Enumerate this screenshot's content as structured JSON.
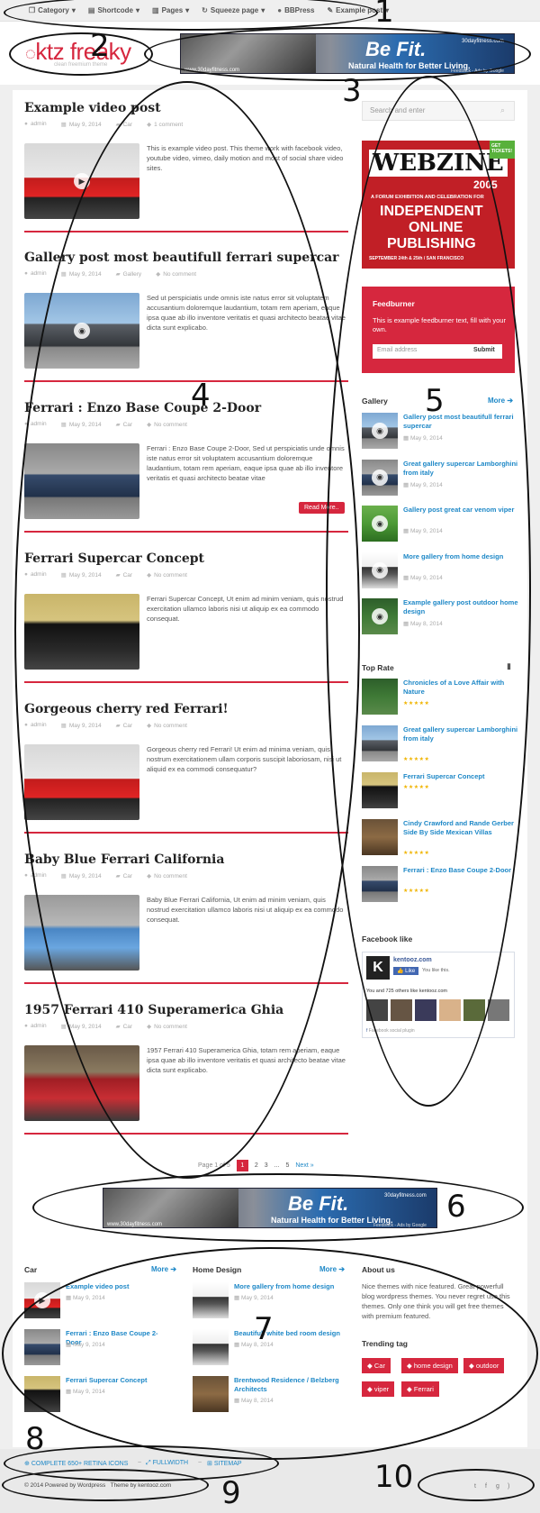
{
  "topnav": {
    "items": [
      {
        "label": "Category",
        "icon": "category-icon"
      },
      {
        "label": "Shortcode",
        "icon": "shortcode-icon"
      },
      {
        "label": "Pages",
        "icon": "pages-icon"
      },
      {
        "label": "Squeeze page",
        "icon": "squeeze-icon"
      },
      {
        "label": "BBPress",
        "icon": "bbpress-icon"
      },
      {
        "label": "Example post",
        "icon": "example-icon"
      }
    ]
  },
  "header": {
    "logo_text": "ktz freaky",
    "logo_tagline": "clean freemium theme"
  },
  "banner": {
    "headline": "Be Fit.",
    "subline": "Natural Health for Better Living.",
    "site_top": "30dayfitness.com",
    "site_bottom": "www.30dayfitness.com",
    "ads_by": "Feedback - Ads by Google"
  },
  "posts": [
    {
      "title": "Example video post",
      "author": "admin",
      "date": "May 9, 2014",
      "category": "Car",
      "comments": "1 comment",
      "excerpt": "This is example video post. This theme work with facebook video, youtube video, vimeo, daily motion and most of social share video sites.",
      "read_more": ""
    },
    {
      "title": "Gallery post most beautifull ferrari supercar",
      "author": "admin",
      "date": "May 9, 2014",
      "category": "Gallery",
      "comments": "No comment",
      "excerpt": "Sed ut perspiciatis unde omnis iste natus error sit voluptatem accusantium doloremque laudantium, totam rem aperiam, eaque ipsa quae ab illo inventore veritatis et quasi architecto beatae vitae dicta sunt explicabo.",
      "read_more": ""
    },
    {
      "title": "Ferrari : Enzo Base Coupe 2-Door",
      "author": "admin",
      "date": "May 9, 2014",
      "category": "Car",
      "comments": "No comment",
      "excerpt": "Ferrari : Enzo Base Coupe 2-Door, Sed ut perspiciatis unde omnis iste natus error sit voluptatem accusantium doloremque laudantium, totam rem aperiam, eaque ipsa quae ab illo inventore veritatis et quasi architecto beatae vitae",
      "read_more": "Read More.."
    },
    {
      "title": "Ferrari Supercar Concept",
      "author": "admin",
      "date": "May 9, 2014",
      "category": "Car",
      "comments": "No comment",
      "excerpt": "Ferrari Supercar Concept, Ut enim ad minim veniam, quis nostrud exercitation ullamco laboris nisi ut aliquip ex ea commodo consequat.",
      "read_more": ""
    },
    {
      "title": "Gorgeous cherry red Ferrari!",
      "author": "admin",
      "date": "May 9, 2014",
      "category": "Car",
      "comments": "No comment",
      "excerpt": "Gorgeous cherry red Ferrari! Ut enim ad minima veniam, quis nostrum exercitationem ullam corporis suscipit laboriosam, nisi ut aliquid ex ea commodi consequatur?",
      "read_more": ""
    },
    {
      "title": "Baby Blue Ferrari California",
      "author": "admin",
      "date": "May 9, 2014",
      "category": "Car",
      "comments": "No comment",
      "excerpt": "Baby Blue Ferrari California, Ut enim ad minim veniam, quis nostrud exercitation ullamco laboris nisi ut aliquip ex ea commodo consequat.",
      "read_more": ""
    },
    {
      "title": "1957 Ferrari 410 Superamerica Ghia",
      "author": "admin",
      "date": "May 9, 2014",
      "category": "Car",
      "comments": "No comment",
      "excerpt": "1957 Ferrari 410 Superamerica Ghia, totam rem aperiam, eaque ipsa quae ab illo inventore veritatis et quasi architecto beatae vitae dicta sunt explicabo.",
      "read_more": ""
    }
  ],
  "pagination": {
    "label": "Page 1 of 5",
    "current": "1",
    "pages": [
      "2",
      "3",
      "...",
      "5"
    ],
    "next": "Next »"
  },
  "sidebar": {
    "search_placeholder": "Search and enter",
    "webzine": {
      "line1": "WEBZINE",
      "line2": "2005",
      "line3": "A FORUM EXHIBITION AND CELEBRATION FOR",
      "line4": "INDEPENDENT",
      "line5": "ONLINE",
      "line6": "PUBLISHING",
      "line7": "SEPTEMBER 24th & 25th / SAN FRANCISCO",
      "corner": "GET TICKETS!"
    },
    "feedburner": {
      "title": "Feedburner",
      "text": "This is example feedburner text, fill with your own.",
      "email_placeholder": "Email address",
      "submit": "Submit"
    },
    "gallery": {
      "title": "Gallery",
      "more": "More",
      "items": [
        {
          "title": "Gallery post most beautifull ferrari supercar",
          "date": "May 9, 2014"
        },
        {
          "title": "Great gallery supercar Lamborghini from italy",
          "date": "May 9, 2014"
        },
        {
          "title": "Gallery post great car venom viper",
          "date": "May 9, 2014"
        },
        {
          "title": "More gallery from home design",
          "date": "May 9, 2014"
        },
        {
          "title": "Example gallery post outdoor home design",
          "date": "May 8, 2014"
        }
      ]
    },
    "top_rate": {
      "title": "Top Rate",
      "items": [
        {
          "title": "Chronicles of a Love Affair with Nature"
        },
        {
          "title": "Great gallery supercar Lamborghini from italy"
        },
        {
          "title": "Ferrari Supercar Concept"
        },
        {
          "title": "Cindy Crawford and Rande Gerber Side By Side Mexican Villas"
        },
        {
          "title": "Ferrari : Enzo Base Coupe 2-Door"
        }
      ]
    },
    "facebook": {
      "title": "Facebook like",
      "page_name": "kentooz.com",
      "like_btn": "Like",
      "you_like": "You like this.",
      "others": "You and 725 others like kentooz.com",
      "plugin": "Facebook social plugin"
    }
  },
  "footer": {
    "car": {
      "title": "Car",
      "more": "More",
      "items": [
        {
          "title": "Example video post",
          "date": "May 9, 2014"
        },
        {
          "title": "Ferrari : Enzo Base Coupe 2-Door",
          "date": "May 9, 2014"
        },
        {
          "title": "Ferrari Supercar Concept",
          "date": "May 9, 2014"
        }
      ]
    },
    "home_design": {
      "title": "Home Design",
      "more": "More",
      "items": [
        {
          "title": "More gallery from home design",
          "date": "May 9, 2014"
        },
        {
          "title": "Beautifull white bed room design",
          "date": "May 8, 2014"
        },
        {
          "title": "Brentwood Residence / Belzberg Architects",
          "date": "May 8, 2014"
        }
      ]
    },
    "about": {
      "title": "About us",
      "text": "Nice themes with nice featured. Great powerfull blog wordpress themes. You never regret use this themes. Only one think you will get free themes with premium featured."
    },
    "trending": {
      "title": "Trending tag",
      "tags": [
        "Car",
        "home design",
        "outdoor",
        "viper",
        "Ferrari"
      ]
    }
  },
  "bottombar": {
    "links": [
      "COMPLETE 650+ RETINA ICONS",
      "FULLWIDTH",
      "SITEMAP"
    ],
    "copyright": "© 2014 Powered by Wordpress   Theme by kentooz.com"
  },
  "annotations": [
    "1",
    "2",
    "3",
    "4",
    "5",
    "6",
    "7",
    "8",
    "9",
    "10"
  ],
  "colors": {
    "accent": "#d6273e",
    "link": "#1e88c7",
    "background": "#efefef"
  }
}
